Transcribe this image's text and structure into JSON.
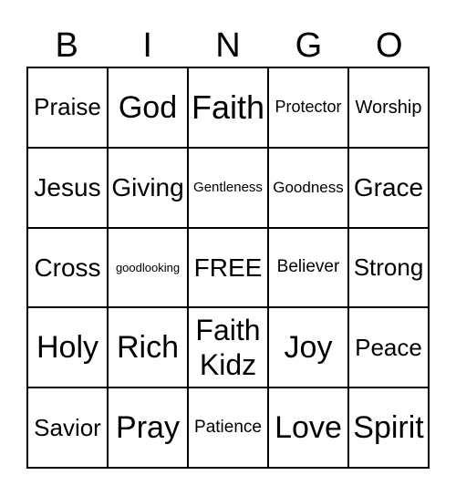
{
  "header": [
    "B",
    "I",
    "N",
    "G",
    "O"
  ],
  "cells": [
    "Praise",
    "God",
    "Faith",
    "Protector",
    "Worship",
    "Jesus",
    "Giving",
    "Gentleness",
    "Goodness",
    "Grace",
    "Cross",
    "goodlooking",
    "FREE",
    "Believer",
    "Strong",
    "Holy",
    "Rich",
    "Faith\nKidz",
    "Joy",
    "Peace",
    "Savior",
    "Pray",
    "Patience",
    "Love",
    "Spirit"
  ]
}
